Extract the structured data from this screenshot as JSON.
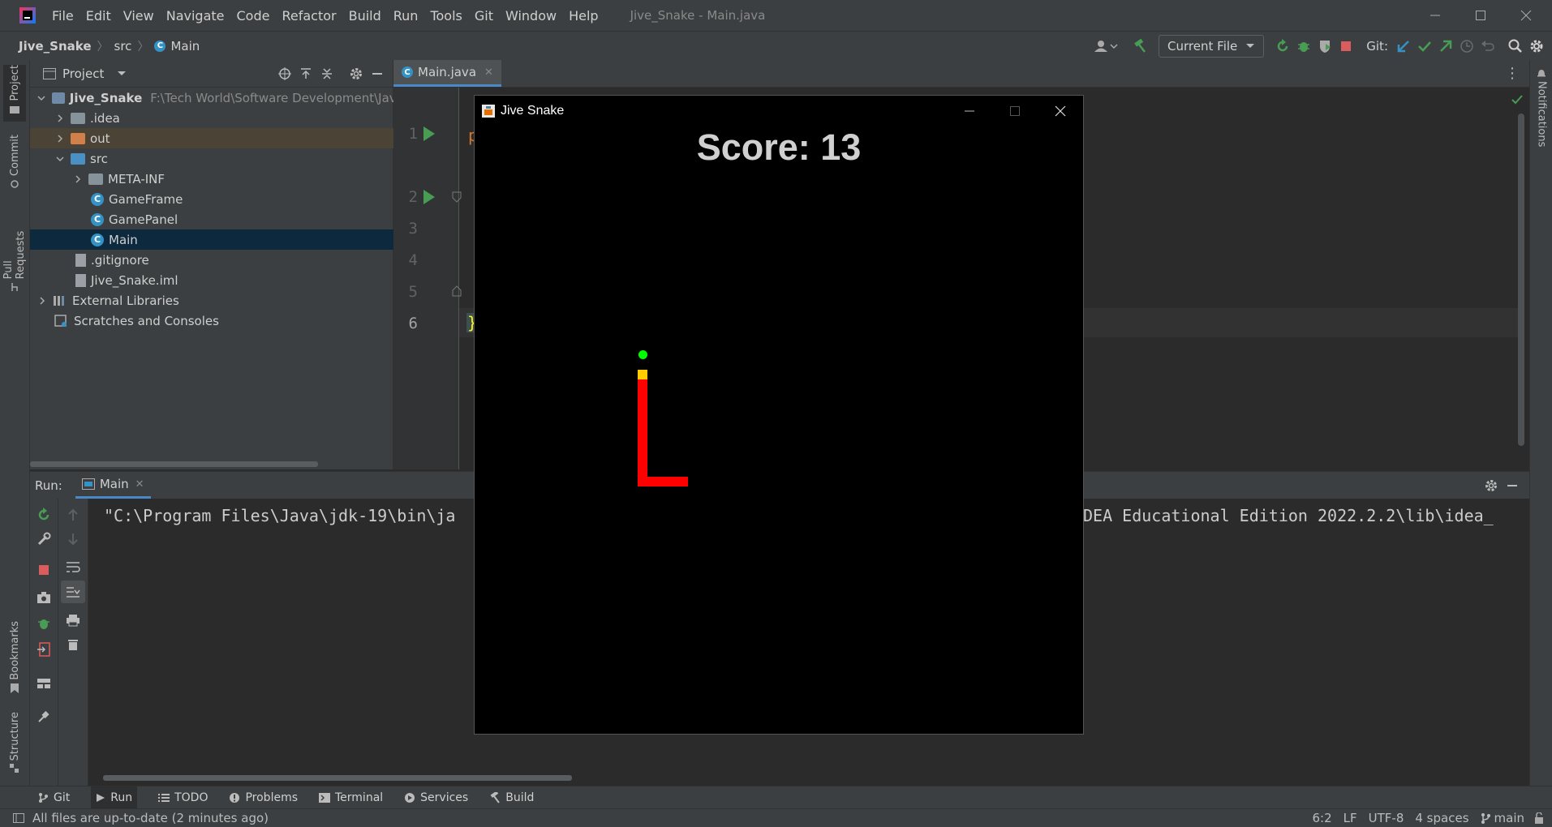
{
  "app": {
    "window_title": "Jive_Snake - Main.java",
    "menu": [
      "File",
      "Edit",
      "View",
      "Navigate",
      "Code",
      "Refactor",
      "Build",
      "Run",
      "Tools",
      "Git",
      "Window",
      "Help"
    ]
  },
  "breadcrumb": [
    "Jive_Snake",
    "src",
    "Main"
  ],
  "toolbar": {
    "run_config": "Current File",
    "git_label": "Git:"
  },
  "left_stripe": {
    "tabs": [
      "Project",
      "Commit",
      "Pull Requests",
      "Bookmarks",
      "Structure"
    ]
  },
  "right_stripe": {
    "tabs": [
      "Notifications"
    ]
  },
  "project_panel": {
    "title": "Project",
    "root": {
      "name": "Jive_Snake",
      "path": "F:\\Tech World\\Software Development\\Java\\Pro"
    },
    "items": [
      {
        "name": ".idea"
      },
      {
        "name": "out"
      },
      {
        "name": "src"
      },
      {
        "name": "META-INF"
      },
      {
        "name": "GameFrame"
      },
      {
        "name": "GamePanel"
      },
      {
        "name": "Main"
      },
      {
        "name": ".gitignore"
      },
      {
        "name": "Jive_Snake.iml"
      },
      {
        "name": "External Libraries"
      },
      {
        "name": "Scratches and Consoles"
      }
    ]
  },
  "editor": {
    "tab": "Main.java",
    "line_numbers": [
      "1",
      "2",
      "3",
      "4",
      "5",
      "6"
    ],
    "partial_line_top": "2",
    "partial_code_p": "p",
    "partial_code_brace": "}"
  },
  "run_panel": {
    "label": "Run:",
    "tab": "Main",
    "console_left": "\"C:\\Program Files\\Java\\jdk-19\\bin\\ja",
    "console_right": "DEA Educational Edition 2022.2.2\\lib\\idea_"
  },
  "game_window": {
    "title": "Jive Snake",
    "score_text": "Score: 13",
    "colors": {
      "background": "#000000",
      "snake_body": "#ff0000",
      "snake_head": "#ffcc00",
      "apple": "#00ff00"
    }
  },
  "bottom_tabs": [
    "Git",
    "Run",
    "TODO",
    "Problems",
    "Terminal",
    "Services",
    "Build"
  ],
  "status": {
    "message": "All files are up-to-date (2 minutes ago)",
    "position": "6:2",
    "line_sep": "LF",
    "encoding": "UTF-8",
    "indent": "4 spaces",
    "branch": "main"
  }
}
